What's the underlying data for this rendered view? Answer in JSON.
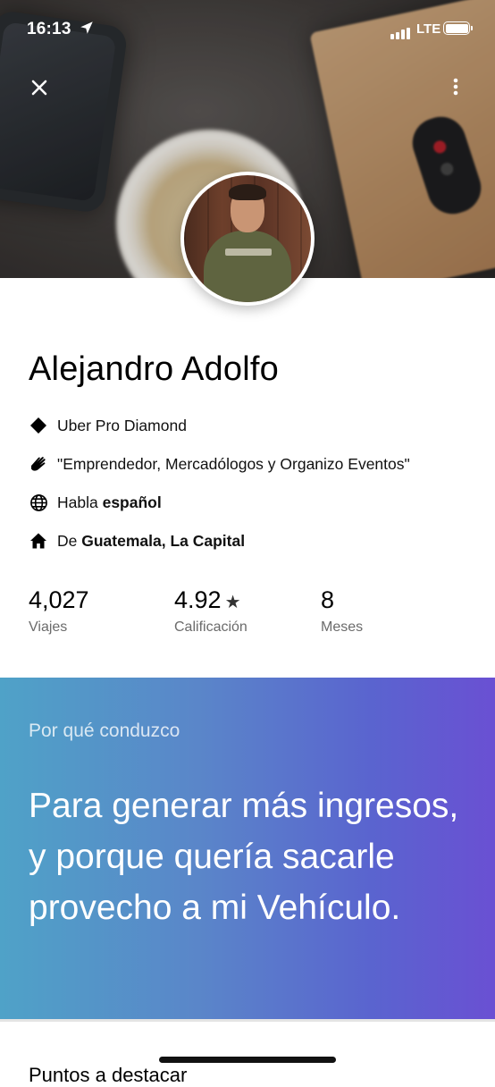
{
  "status_bar": {
    "time": "16:13",
    "network": "LTE",
    "signal_bars": 4,
    "battery_level": 0.9
  },
  "header": {
    "close_icon": "close-icon",
    "more_icon": "more-vertical-icon"
  },
  "profile": {
    "name": "Alejandro Adolfo",
    "tier": "Uber Pro Diamond",
    "tagline": "\"Emprendedor, Mercadólogos y Organizo Eventos\"",
    "language_prefix": "Habla ",
    "language": "español",
    "hometown_prefix": "De ",
    "hometown": "Guatemala, La Capital"
  },
  "stats": [
    {
      "value": "4,027",
      "label": "Viajes"
    },
    {
      "value": "4.92",
      "label": "Calificación",
      "icon": "star-icon"
    },
    {
      "value": "8",
      "label": "Meses"
    }
  ],
  "why_section": {
    "title": "Por qué conduzco",
    "quote": "Para generar más ingresos, y porque quería sacarle provecho a mi Vehículo."
  },
  "next_section": {
    "heading": "Puntos a destacar"
  },
  "colors": {
    "gradient_start": "#4fa2c8",
    "gradient_end": "#6a50d3",
    "secondary_text": "#6b6b6b"
  }
}
